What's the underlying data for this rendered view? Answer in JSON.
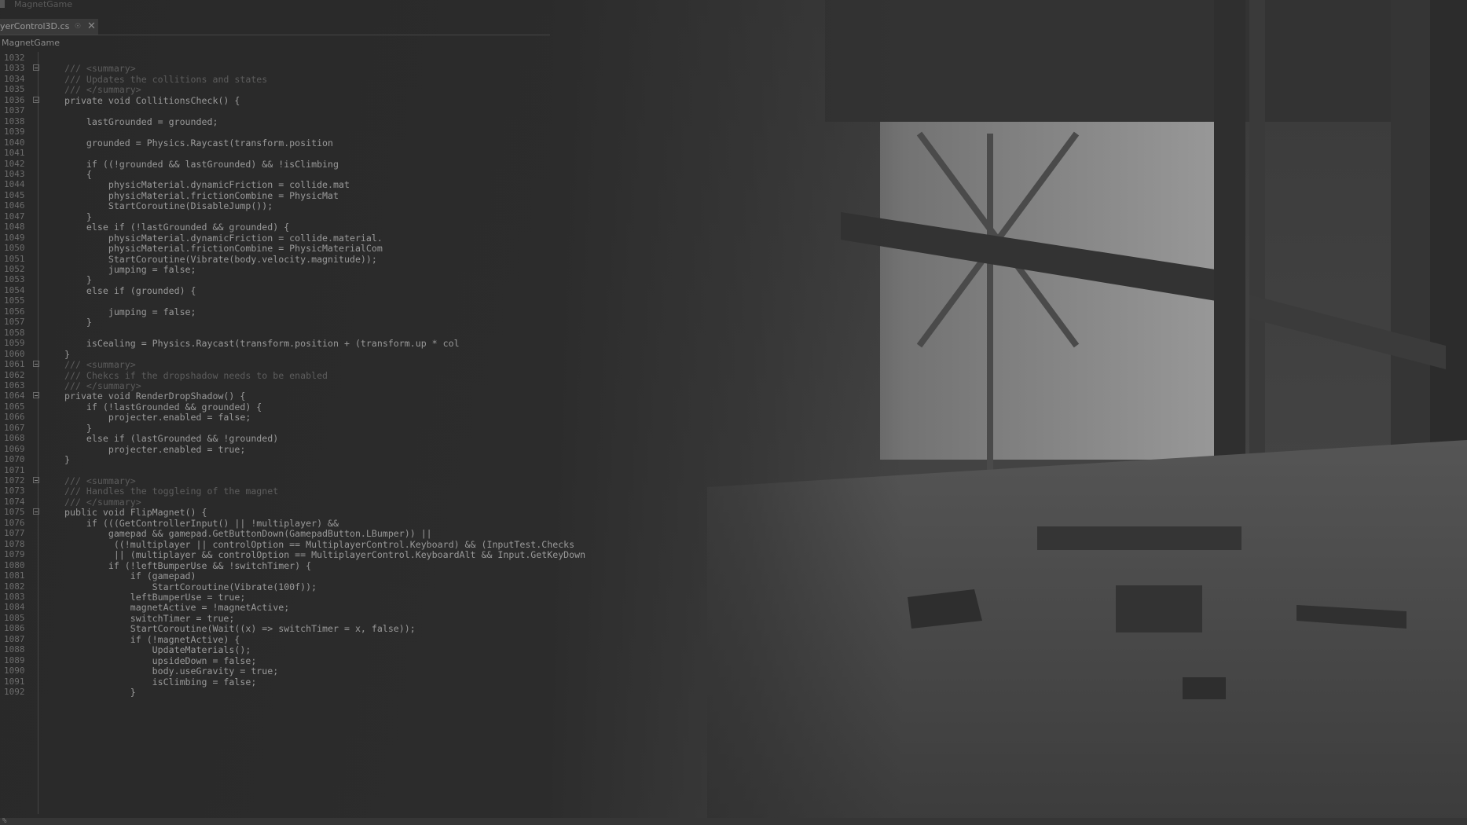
{
  "window": {
    "title": "MagnetGame"
  },
  "tab": {
    "label": "yerControl3D.cs"
  },
  "nav": {
    "project": "MagnetGame"
  },
  "status": {
    "zoom": "%"
  },
  "code": {
    "lines": [
      {
        "n": "1032",
        "t": "",
        "c": false,
        "f": false
      },
      {
        "n": "1033",
        "t": "/// <summary>",
        "c": true,
        "f": true
      },
      {
        "n": "1034",
        "t": "/// Updates the collitions and states",
        "c": true,
        "f": false
      },
      {
        "n": "1035",
        "t": "/// </summary>",
        "c": true,
        "f": false
      },
      {
        "n": "1036",
        "t": "private void CollitionsCheck() {",
        "c": false,
        "f": true
      },
      {
        "n": "1037",
        "t": "",
        "c": false,
        "f": false
      },
      {
        "n": "1038",
        "t": "    lastGrounded = grounded;",
        "c": false,
        "f": false
      },
      {
        "n": "1039",
        "t": "",
        "c": false,
        "f": false
      },
      {
        "n": "1040",
        "t": "    grounded = Physics.Raycast(transform.position",
        "c": false,
        "f": false
      },
      {
        "n": "1041",
        "t": "",
        "c": false,
        "f": false
      },
      {
        "n": "1042",
        "t": "    if ((!grounded && lastGrounded) && !isClimbing",
        "c": false,
        "f": false
      },
      {
        "n": "1043",
        "t": "    {",
        "c": false,
        "f": false
      },
      {
        "n": "1044",
        "t": "        physicMaterial.dynamicFriction = collide.mat",
        "c": false,
        "f": false
      },
      {
        "n": "1045",
        "t": "        physicMaterial.frictionCombine = PhysicMat",
        "c": false,
        "f": false
      },
      {
        "n": "1046",
        "t": "        StartCoroutine(DisableJump());",
        "c": false,
        "f": false
      },
      {
        "n": "1047",
        "t": "    }",
        "c": false,
        "f": false
      },
      {
        "n": "1048",
        "t": "    else if (!lastGrounded && grounded) {",
        "c": false,
        "f": false
      },
      {
        "n": "1049",
        "t": "        physicMaterial.dynamicFriction = collide.material.",
        "c": false,
        "f": false
      },
      {
        "n": "1050",
        "t": "        physicMaterial.frictionCombine = PhysicMaterialCom",
        "c": false,
        "f": false
      },
      {
        "n": "1051",
        "t": "        StartCoroutine(Vibrate(body.velocity.magnitude));",
        "c": false,
        "f": false
      },
      {
        "n": "1052",
        "t": "        jumping = false;",
        "c": false,
        "f": false
      },
      {
        "n": "1053",
        "t": "    }",
        "c": false,
        "f": false
      },
      {
        "n": "1054",
        "t": "    else if (grounded) {",
        "c": false,
        "f": false
      },
      {
        "n": "1055",
        "t": "",
        "c": false,
        "f": false
      },
      {
        "n": "1056",
        "t": "        jumping = false;",
        "c": false,
        "f": false
      },
      {
        "n": "1057",
        "t": "    }",
        "c": false,
        "f": false
      },
      {
        "n": "1058",
        "t": "",
        "c": false,
        "f": false
      },
      {
        "n": "1059",
        "t": "    isCealing = Physics.Raycast(transform.position + (transform.up * col",
        "c": false,
        "f": false
      },
      {
        "n": "1060",
        "t": "}",
        "c": false,
        "f": false
      },
      {
        "n": "1061",
        "t": "/// <summary>",
        "c": true,
        "f": true
      },
      {
        "n": "1062",
        "t": "/// Chekcs if the dropshadow needs to be enabled",
        "c": true,
        "f": false
      },
      {
        "n": "1063",
        "t": "/// </summary>",
        "c": true,
        "f": false
      },
      {
        "n": "1064",
        "t": "private void RenderDropShadow() {",
        "c": false,
        "f": true
      },
      {
        "n": "1065",
        "t": "    if (!lastGrounded && grounded) {",
        "c": false,
        "f": false
      },
      {
        "n": "1066",
        "t": "        projecter.enabled = false;",
        "c": false,
        "f": false
      },
      {
        "n": "1067",
        "t": "    }",
        "c": false,
        "f": false
      },
      {
        "n": "1068",
        "t": "    else if (lastGrounded && !grounded)",
        "c": false,
        "f": false
      },
      {
        "n": "1069",
        "t": "        projecter.enabled = true;",
        "c": false,
        "f": false
      },
      {
        "n": "1070",
        "t": "}",
        "c": false,
        "f": false
      },
      {
        "n": "1071",
        "t": "",
        "c": false,
        "f": false
      },
      {
        "n": "1072",
        "t": "/// <summary>",
        "c": true,
        "f": true
      },
      {
        "n": "1073",
        "t": "/// Handles the toggleing of the magnet",
        "c": true,
        "f": false
      },
      {
        "n": "1074",
        "t": "/// </summary>",
        "c": true,
        "f": false
      },
      {
        "n": "1075",
        "t": "public void FlipMagnet() {",
        "c": false,
        "f": true
      },
      {
        "n": "1076",
        "t": "    if (((GetControllerInput() || !multiplayer) &&",
        "c": false,
        "f": false
      },
      {
        "n": "1077",
        "t": "        gamepad && gamepad.GetButtonDown(GamepadButton.LBumper)) ||",
        "c": false,
        "f": false
      },
      {
        "n": "1078",
        "t": "         ((!multiplayer || controlOption == MultiplayerControl.Keyboard) && (InputTest.Checks",
        "c": false,
        "f": false
      },
      {
        "n": "1079",
        "t": "         || (multiplayer && controlOption == MultiplayerControl.KeyboardAlt && Input.GetKeyDown",
        "c": false,
        "f": false
      },
      {
        "n": "1080",
        "t": "        if (!leftBumperUse && !switchTimer) {",
        "c": false,
        "f": false
      },
      {
        "n": "1081",
        "t": "            if (gamepad)",
        "c": false,
        "f": false
      },
      {
        "n": "1082",
        "t": "                StartCoroutine(Vibrate(100f));",
        "c": false,
        "f": false
      },
      {
        "n": "1083",
        "t": "            leftBumperUse = true;",
        "c": false,
        "f": false
      },
      {
        "n": "1084",
        "t": "            magnetActive = !magnetActive;",
        "c": false,
        "f": false
      },
      {
        "n": "1085",
        "t": "            switchTimer = true;",
        "c": false,
        "f": false
      },
      {
        "n": "1086",
        "t": "            StartCoroutine(Wait((x) => switchTimer = x, false));",
        "c": false,
        "f": false
      },
      {
        "n": "1087",
        "t": "            if (!magnetActive) {",
        "c": false,
        "f": false
      },
      {
        "n": "1088",
        "t": "                UpdateMaterials();",
        "c": false,
        "f": false
      },
      {
        "n": "1089",
        "t": "                upsideDown = false;",
        "c": false,
        "f": false
      },
      {
        "n": "1090",
        "t": "                body.useGravity = true;",
        "c": false,
        "f": false
      },
      {
        "n": "1091",
        "t": "                isClimbing = false;",
        "c": false,
        "f": false
      },
      {
        "n": "1092",
        "t": "            }",
        "c": false,
        "f": false
      }
    ]
  }
}
